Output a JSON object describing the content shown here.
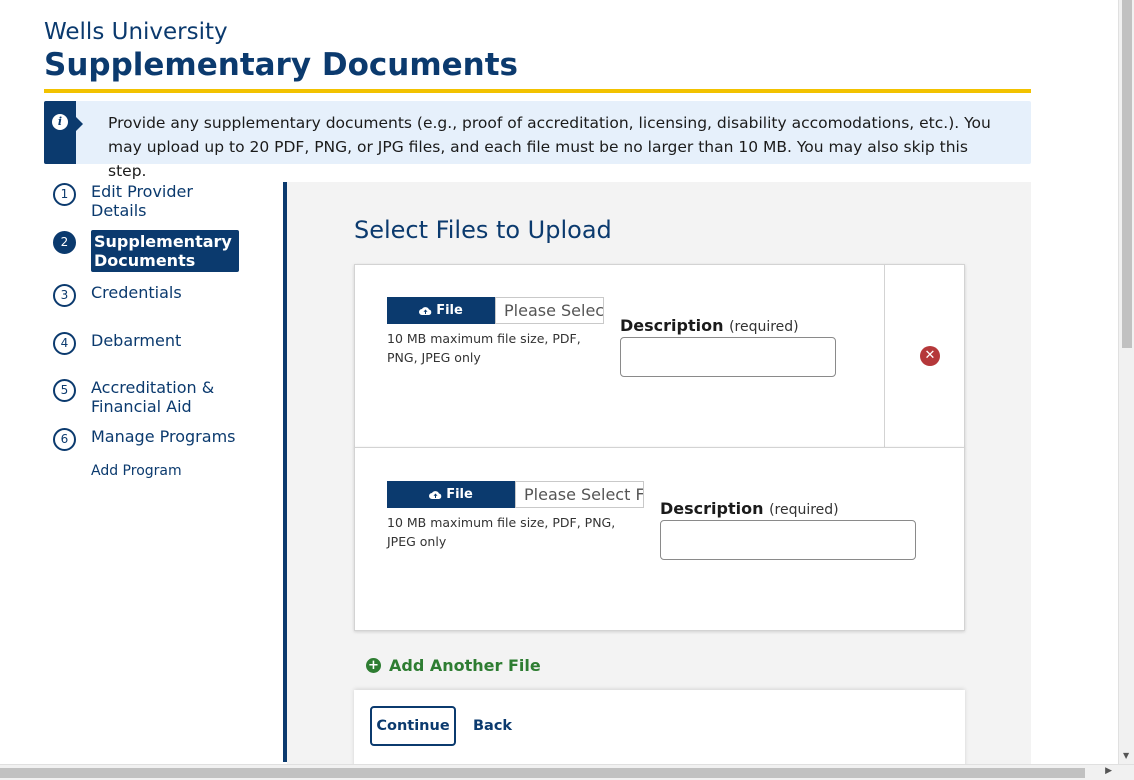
{
  "header": {
    "university": "Wells University",
    "title": "Supplementary Documents"
  },
  "alert": {
    "icon": "info-icon",
    "text": "Provide any supplementary documents (e.g., proof of accreditation, licensing, disability accomodations, etc.). You may upload up to 20 PDF, PNG, or JPG files, and each file must be no larger than 10 MB. You may also skip this step."
  },
  "steps": [
    {
      "num": "1",
      "label": "Edit Provider Details",
      "active": false
    },
    {
      "num": "2",
      "label": "Supplementary Documents",
      "active": true
    },
    {
      "num": "3",
      "label": "Credentials",
      "active": false
    },
    {
      "num": "4",
      "label": "Debarment",
      "active": false
    },
    {
      "num": "5",
      "label": "Accreditation & Financial Aid",
      "active": false
    },
    {
      "num": "6",
      "label": "Manage Programs",
      "active": false
    }
  ],
  "sub_link": "Add Program",
  "main": {
    "section_title": "Select Files to Upload",
    "files": [
      {
        "button_label": "File",
        "file_placeholder": "Please Selec",
        "help": "10 MB maximum file size, PDF, PNG, JPEG only",
        "desc_label": "Description",
        "desc_required": "(required)",
        "desc_value": ""
      },
      {
        "button_label": "File",
        "file_placeholder": "Please Select Fi",
        "help": "10 MB maximum file size, PDF, PNG, JPEG only",
        "desc_label": "Description",
        "desc_required": "(required)",
        "desc_value": ""
      }
    ],
    "add_file_label": "Add Another File",
    "continue_label": "Continue",
    "back_label": "Back"
  },
  "colors": {
    "primary": "#0b3a6e",
    "accent": "#f2c200",
    "success": "#2e7d32",
    "danger": "#b5383a"
  }
}
